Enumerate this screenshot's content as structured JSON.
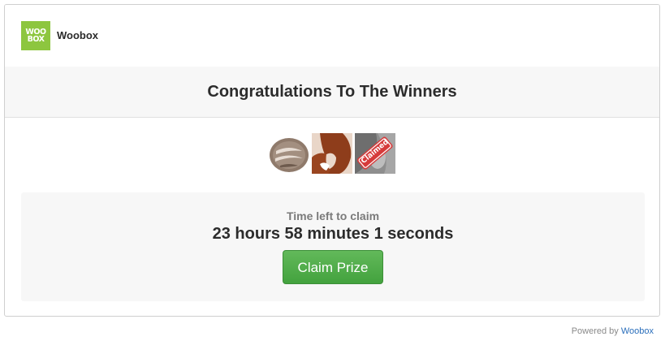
{
  "header": {
    "logo_line1": "WOO",
    "logo_line2": "BOX",
    "brand_name": "Woobox"
  },
  "main": {
    "title": "Congratulations To The Winners",
    "winners": [
      {
        "avatar": "avatar-1",
        "claimed": false
      },
      {
        "avatar": "avatar-2",
        "claimed": false
      },
      {
        "avatar": "avatar-3",
        "claimed": true,
        "stamp": "Claimed"
      }
    ],
    "claim": {
      "label": "Time left to claim",
      "countdown": "23 hours 58 minutes 1 seconds",
      "button_label": "Claim Prize"
    }
  },
  "footer": {
    "powered_by": "Powered by",
    "link_text": "Woobox"
  },
  "colors": {
    "brand_green": "#8dc63f",
    "button_green": "#4cae46",
    "link_blue": "#2a6ebb"
  }
}
